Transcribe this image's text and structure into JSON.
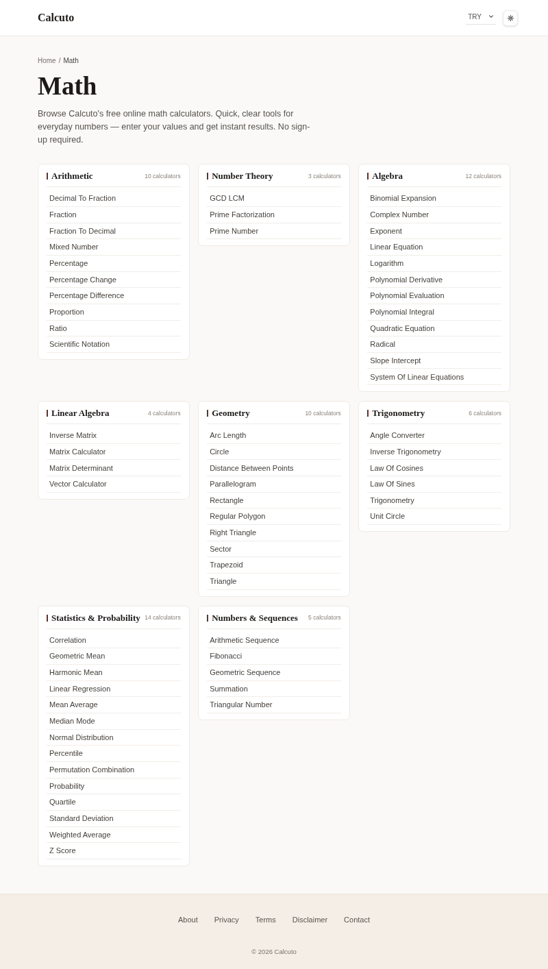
{
  "header": {
    "logo": "Calcuto",
    "currency": {
      "value": "TRY"
    }
  },
  "breadcrumb": {
    "items": [
      "Home",
      "Math"
    ],
    "separator": "/"
  },
  "page": {
    "title": "Math",
    "description": "Browse Calcuto's free online math calculators. Quick, clear tools for everyday numbers — enter your values and get instant results. No sign-up required."
  },
  "categories": [
    {
      "title": "Arithmetic",
      "count": "10 calculators",
      "items": [
        "Decimal To Fraction",
        "Fraction",
        "Fraction To Decimal",
        "Mixed Number",
        "Percentage",
        "Percentage Change",
        "Percentage Difference",
        "Proportion",
        "Ratio",
        "Scientific Notation"
      ]
    },
    {
      "title": "Number Theory",
      "count": "3 calculators",
      "items": [
        "GCD LCM",
        "Prime Factorization",
        "Prime Number"
      ]
    },
    {
      "title": "Algebra",
      "count": "12 calculators",
      "items": [
        "Binomial Expansion",
        "Complex Number",
        "Exponent",
        "Linear Equation",
        "Logarithm",
        "Polynomial Derivative",
        "Polynomial Evaluation",
        "Polynomial Integral",
        "Quadratic Equation",
        "Radical",
        "Slope Intercept",
        "System Of Linear Equations"
      ]
    },
    {
      "title": "Linear Algebra",
      "count": "4 calculators",
      "items": [
        "Inverse Matrix",
        "Matrix Calculator",
        "Matrix Determinant",
        "Vector Calculator"
      ]
    },
    {
      "title": "Geometry",
      "count": "10 calculators",
      "items": [
        "Arc Length",
        "Circle",
        "Distance Between Points",
        "Parallelogram",
        "Rectangle",
        "Regular Polygon",
        "Right Triangle",
        "Sector",
        "Trapezoid",
        "Triangle"
      ]
    },
    {
      "title": "Trigonometry",
      "count": "6 calculators",
      "items": [
        "Angle Converter",
        "Inverse Trigonometry",
        "Law Of Cosines",
        "Law Of Sines",
        "Trigonometry",
        "Unit Circle"
      ]
    },
    {
      "title": "Statistics & Probability",
      "count": "14 calculators",
      "items": [
        "Correlation",
        "Geometric Mean",
        "Harmonic Mean",
        "Linear Regression",
        "Mean Average",
        "Median Mode",
        "Normal Distribution",
        "Percentile",
        "Permutation Combination",
        "Probability",
        "Quartile",
        "Standard Deviation",
        "Weighted Average",
        "Z Score"
      ]
    },
    {
      "title": "Numbers & Sequences",
      "count": "5 calculators",
      "items": [
        "Arithmetic Sequence",
        "Fibonacci",
        "Geometric Sequence",
        "Summation",
        "Triangular Number"
      ]
    }
  ],
  "footer": {
    "links": [
      "About",
      "Privacy",
      "Terms",
      "Disclaimer",
      "Contact"
    ],
    "copyright": "© 2026 Calcuto"
  }
}
